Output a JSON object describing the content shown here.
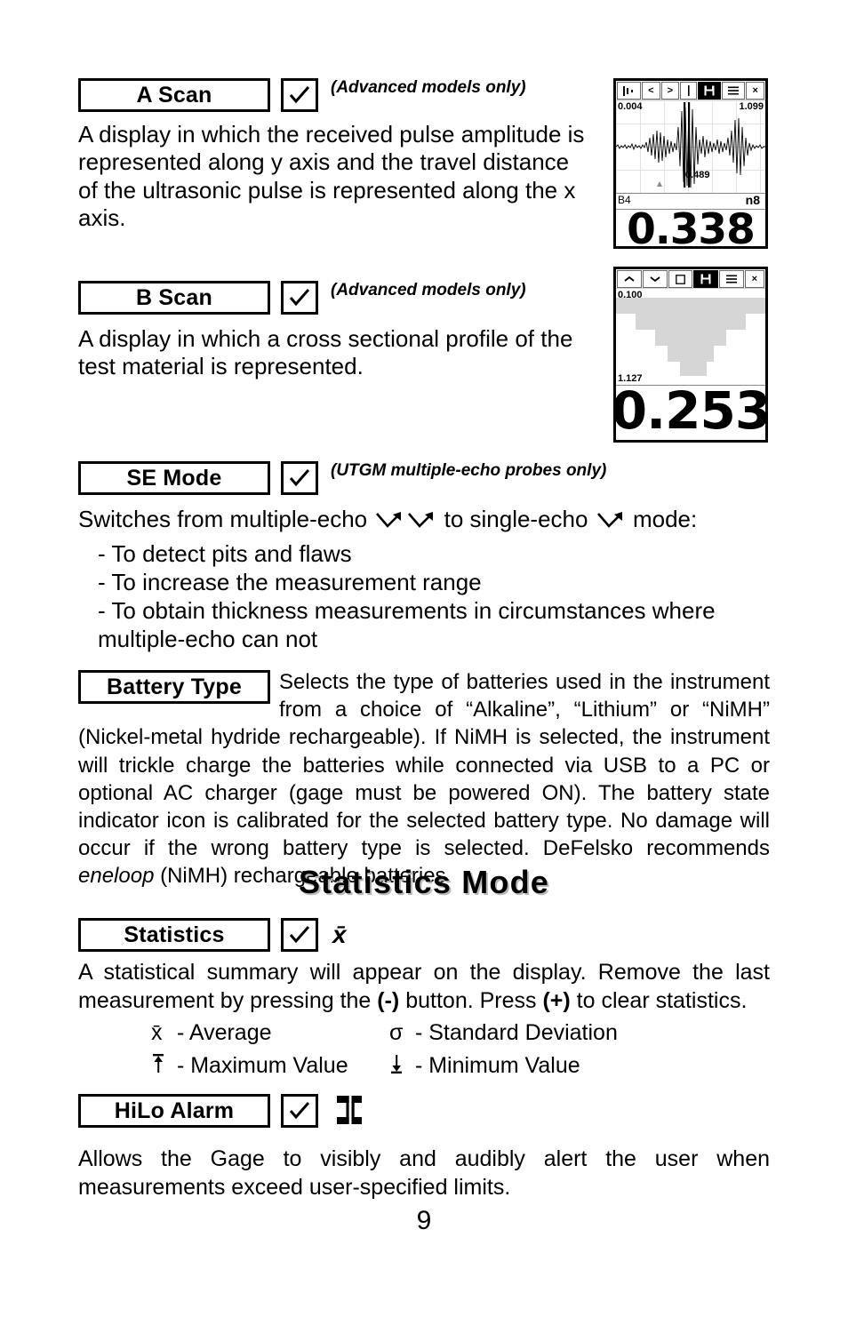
{
  "page": {
    "number": "9",
    "heading": "Statistics Mode"
  },
  "sections": {
    "a_scan": {
      "label": "A Scan",
      "check": "✓",
      "note": "(Advanced models only)",
      "description": "A display in which the received pulse amplitude is represented along y axis and the travel distance of the ultrasonic pulse is represented along the x axis."
    },
    "b_scan": {
      "label": "B Scan",
      "check": "✓",
      "note": "(Advanced models only)",
      "description": "A display in which a cross sectional profile of the test material is represented."
    },
    "se_mode": {
      "label": "SE Mode",
      "check": "✓",
      "note": "(UTGM multiple-echo probes only)",
      "lead_1": "Switches from multiple-echo",
      "lead_2": "to single-echo",
      "lead_3": "mode:",
      "bullets": [
        "- To detect pits and flaws",
        "- To increase the measurement range",
        "- To obtain thickness measurements in circumstances where multiple-echo can not"
      ]
    },
    "battery_type": {
      "label": "Battery Type",
      "paragraph": "Selects the type of batteries used in the instrument from a choice of “Alkaline”, “Lithium” or “NiMH” (Nickel-metal hydride rechargeable). If NiMH is selected, the instrument will trickle charge the batteries while connected via USB to a PC or optional AC charger (gage must be powered ON). The battery state indicator icon is calibrated for the selected battery type. No damage will occur if the wrong battery type is selected. DeFelsko recommends ",
      "paragraph_italic": "eneloop",
      "paragraph_end": " (NiMH) rechargeable batteries."
    },
    "statistics": {
      "label": "Statistics",
      "check": "✓",
      "icon_symbol": "x̄",
      "desc_1": "A statistical summary will appear on the display. Remove the last measurement by pressing the ",
      "desc_minus": "(-)",
      "desc_2": " button.   Press ",
      "desc_plus": "(+)",
      "desc_3": " to clear statistics.",
      "legend": [
        {
          "symbol": "x̄",
          "text": "- Average"
        },
        {
          "symbol": "σ",
          "text": "- Standard Deviation"
        },
        {
          "symbol": "↑",
          "text": "- Maximum Value"
        },
        {
          "symbol": "↓",
          "text": "- Minimum Value"
        }
      ]
    },
    "hilo_alarm": {
      "label": "HiLo Alarm",
      "check": "✓",
      "description": "Allows the Gage to visibly and audibly alert the user when measurements exceed user-specified limits."
    }
  },
  "gage_ascan": {
    "toolbar": [
      "|I·",
      "<",
      ">",
      "|",
      "save",
      "menu",
      "×"
    ],
    "selected_tool_index": 4,
    "label_left": "0.004",
    "label_right": "1.099",
    "label_gate": "0.489",
    "status_left": "B4",
    "status_right": "n8",
    "reading": "0.338"
  },
  "gage_bscan": {
    "toolbar": [
      "˄",
      "˅",
      "▢",
      "save",
      "menu",
      "×"
    ],
    "selected_tool_index": 3,
    "label_top": "0.100",
    "label_bottom": "1.127",
    "reading": "0.253",
    "profile_heights": [
      14,
      14,
      62,
      62,
      62,
      78,
      78,
      92,
      92,
      92,
      78,
      78,
      62,
      62,
      40,
      40
    ]
  },
  "colors": {
    "ink": "#000000",
    "paper": "#ffffff",
    "profile_fill": "#d6d6d6",
    "grid": "#e3e3e3",
    "heading_shadow": "#b9b9b9"
  }
}
